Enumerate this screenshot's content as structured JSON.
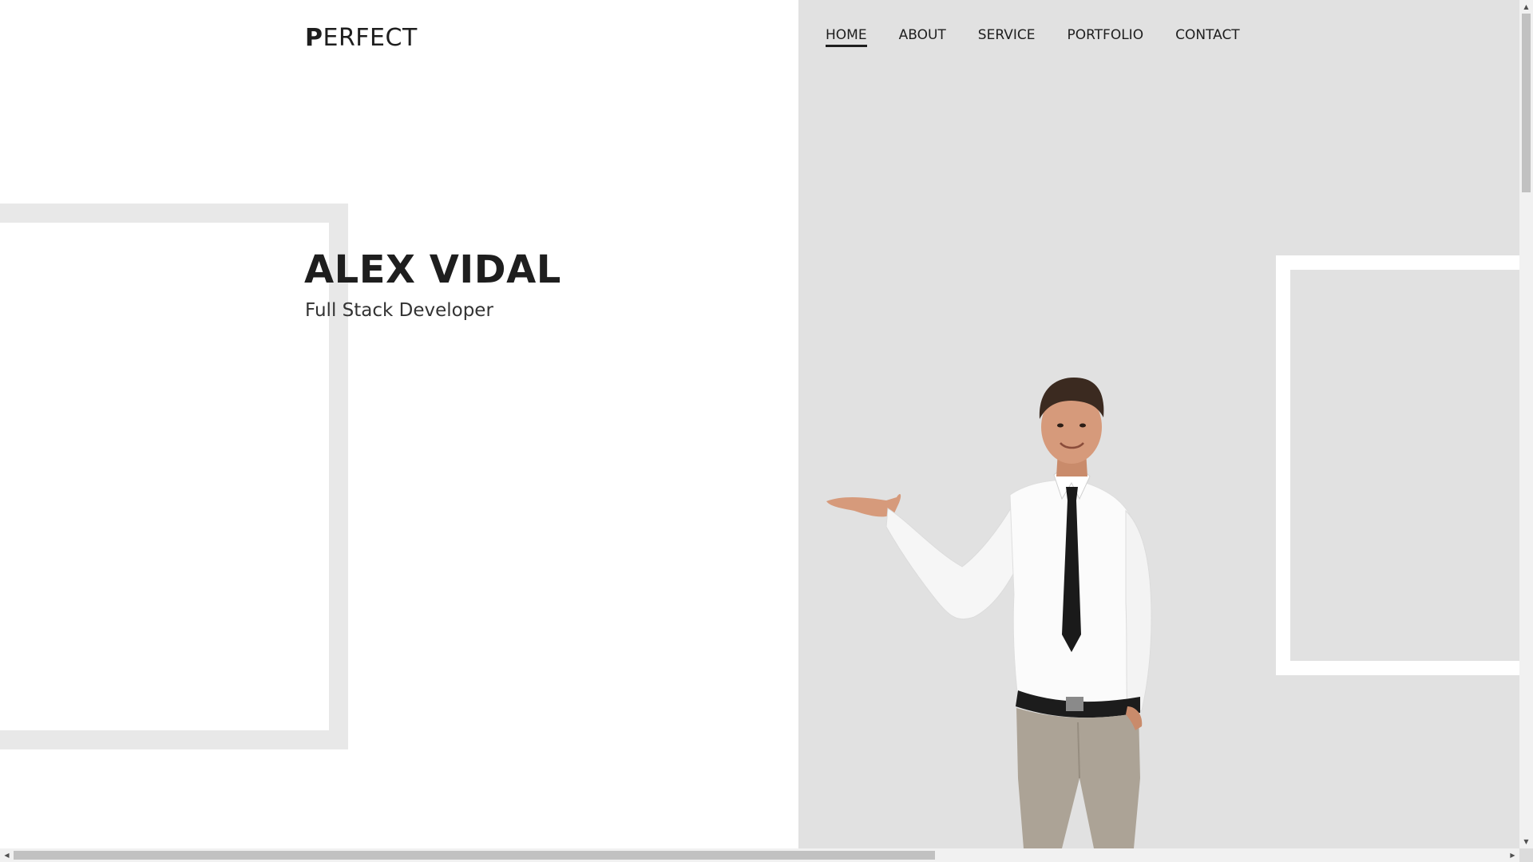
{
  "brand": {
    "logo_mark": "P",
    "logo_text": "ERFECT"
  },
  "nav": {
    "items": [
      {
        "label": "HOME",
        "active": true
      },
      {
        "label": "ABOUT",
        "active": false
      },
      {
        "label": "SERVICE",
        "active": false
      },
      {
        "label": "PORTFOLIO",
        "active": false
      },
      {
        "label": "CONTACT",
        "active": false
      }
    ]
  },
  "hero": {
    "name": "ALEX VIDAL",
    "role": "Full Stack Developer"
  },
  "colors": {
    "left_background": "#ffffff",
    "right_background": "#e1e1e1",
    "frame_left": "#e8e8e8",
    "frame_right": "#ffffff",
    "text_dark": "#1e1e1e"
  },
  "icons": {
    "scroll_up": "scroll-up-arrow-icon",
    "scroll_down": "scroll-down-arrow-icon",
    "scroll_left": "scroll-left-arrow-icon",
    "scroll_right": "scroll-right-arrow-icon"
  }
}
